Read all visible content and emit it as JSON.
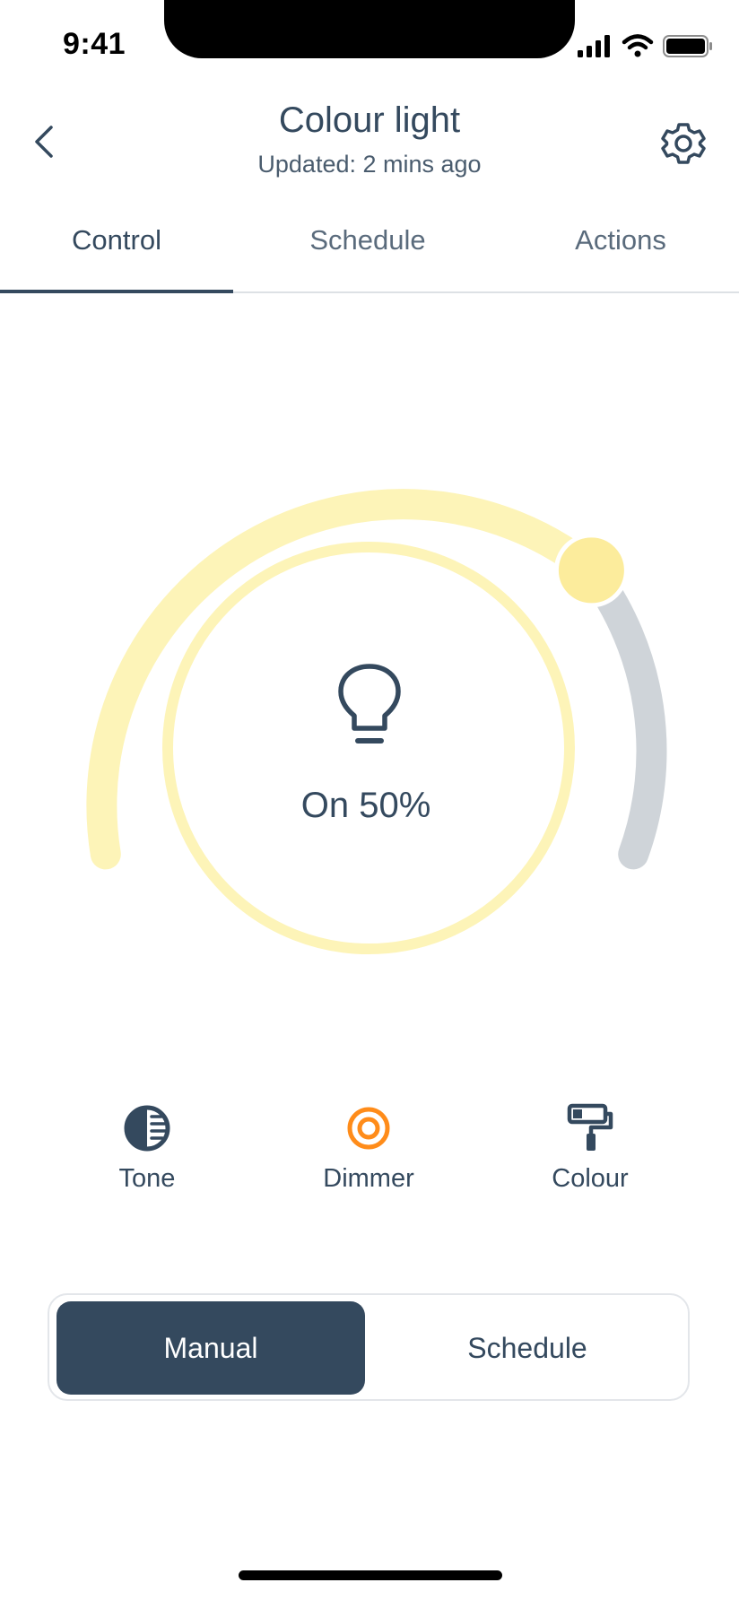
{
  "status_bar": {
    "time": "9:41",
    "icons": [
      "signal-icon",
      "wifi-icon",
      "battery-icon"
    ]
  },
  "header": {
    "back_icon": "chevron-left-icon",
    "title": "Colour light",
    "subtitle": "Updated: 2 mins ago",
    "settings_icon": "gear-icon"
  },
  "tabs": [
    {
      "label": "Control",
      "active": true
    },
    {
      "label": "Schedule",
      "active": false
    },
    {
      "label": "Actions",
      "active": false
    }
  ],
  "dimmer": {
    "level_percent": 50,
    "status_text": "On 50%",
    "icon": "lightbulb-icon",
    "colors": {
      "active_track": "#fdf4b8",
      "inactive_track": "#cfd4d9",
      "knob": "#fcec9c",
      "inner_ring": "#fdf4b8"
    }
  },
  "modes": [
    {
      "label": "Tone",
      "icon": "tone-icon",
      "active": false
    },
    {
      "label": "Dimmer",
      "icon": "dimmer-icon",
      "active": true
    },
    {
      "label": "Colour",
      "icon": "paint-roller-icon",
      "active": false
    }
  ],
  "mode_switch": {
    "options": [
      "Manual",
      "Schedule"
    ],
    "selected": "Manual"
  },
  "colors": {
    "primary": "#34495e",
    "accent": "#ff8c1a",
    "background": "#ffffff"
  }
}
